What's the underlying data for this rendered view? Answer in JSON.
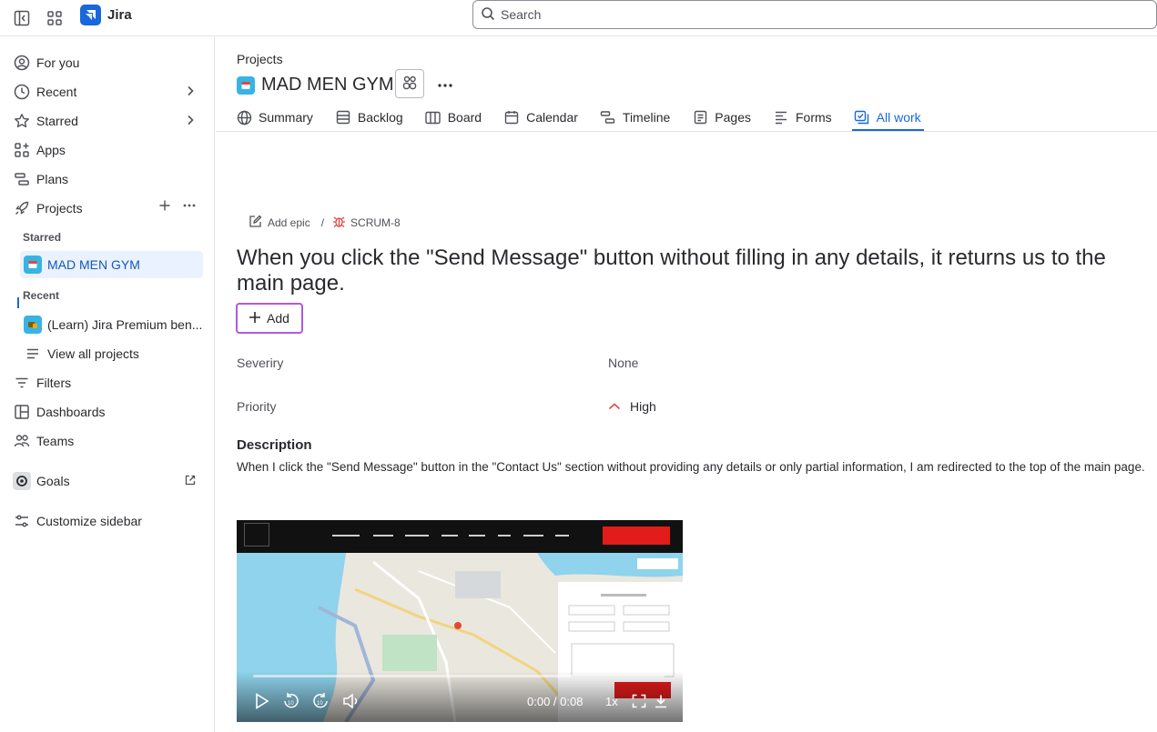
{
  "app": {
    "name": "Jira"
  },
  "search": {
    "placeholder": "Search"
  },
  "sidebar": {
    "for_you": "For you",
    "recent": "Recent",
    "starred": "Starred",
    "apps": "Apps",
    "plans": "Plans",
    "projects": "Projects",
    "starred_heading": "Starred",
    "starred_project": "MAD MEN GYM",
    "recent_heading": "Recent",
    "recent_project": "(Learn) Jira Premium ben...",
    "view_all": "View all projects",
    "filters": "Filters",
    "dashboards": "Dashboards",
    "teams": "Teams",
    "goals": "Goals",
    "customize": "Customize sidebar"
  },
  "header": {
    "breadcrumb": "Projects",
    "project_name": "MAD MEN GYM",
    "tabs": [
      {
        "label": "Summary",
        "icon": "globe-icon"
      },
      {
        "label": "Backlog",
        "icon": "backlog-icon"
      },
      {
        "label": "Board",
        "icon": "board-icon"
      },
      {
        "label": "Calendar",
        "icon": "calendar-icon"
      },
      {
        "label": "Timeline",
        "icon": "timeline-icon"
      },
      {
        "label": "Pages",
        "icon": "pages-icon"
      },
      {
        "label": "Forms",
        "icon": "forms-icon"
      },
      {
        "label": "All work",
        "icon": "all-work-icon",
        "active": true
      }
    ]
  },
  "issue": {
    "add_epic": "Add epic",
    "separator": "/",
    "key": "SCRUM-8",
    "title": "When you click the \"Send Message\" button without filling in any details, it returns us to the main page.",
    "add_label": "Add",
    "fields": {
      "severity_label": "Severiry",
      "severity_value": "None",
      "priority_label": "Priority",
      "priority_value": "High"
    },
    "description_heading": "Description",
    "description_text": "When I click the \"Send Message\" button in the \"Contact Us\" section without providing any details or only partial information, I am redirected to the top of the main page.",
    "video": {
      "time": "0:00 / 0:08",
      "speed": "1x",
      "progress": 0
    }
  },
  "colors": {
    "accent": "#1868DB",
    "selected_bg": "#E9F2FE",
    "bug_red": "#E2483D",
    "focus_purple": "#AF59E1"
  }
}
